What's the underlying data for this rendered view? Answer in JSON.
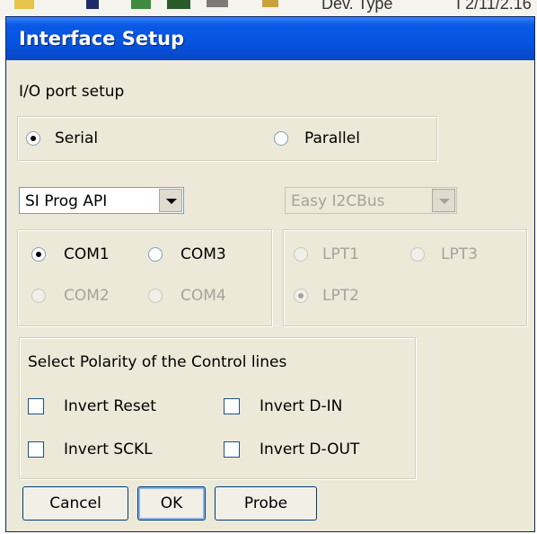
{
  "background_window": {
    "col1": "Dev. Type",
    "col2": "I 2/11/2.16"
  },
  "dialog": {
    "title": "Interface Setup",
    "io_section_label": "I/O port setup",
    "mode": {
      "serial_label": "Serial",
      "parallel_label": "Parallel",
      "selected": "Serial"
    },
    "serial_driver": {
      "value": "SI Prog API"
    },
    "parallel_driver": {
      "value": "Easy I2CBus"
    },
    "com_ports": {
      "com1": "COM1",
      "com3": "COM3",
      "com2": "COM2",
      "com4": "COM4",
      "selected": "COM1"
    },
    "lpt_ports": {
      "lpt1": "LPT1",
      "lpt3": "LPT3",
      "lpt2": "LPT2",
      "selected": "LPT2"
    },
    "polarity": {
      "heading": "Select Polarity of the Control lines",
      "invert_reset": "Invert Reset",
      "invert_din": "Invert D-IN",
      "invert_sckl": "Invert SCKL",
      "invert_dout": "Invert D-OUT"
    },
    "buttons": {
      "cancel": "Cancel",
      "ok": "OK",
      "probe": "Probe"
    }
  },
  "colors": {
    "title_bar": "#0553df",
    "dialog_face": "#ece9d8",
    "disabled_text": "#a5a29b"
  }
}
